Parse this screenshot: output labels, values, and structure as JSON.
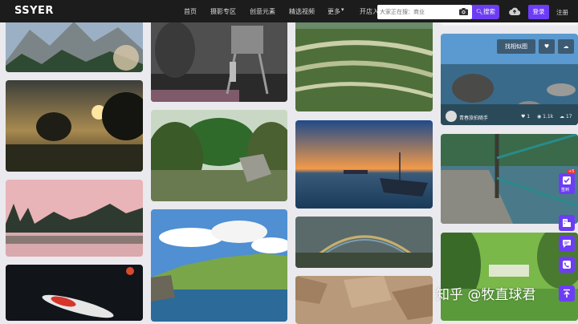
{
  "brand": {
    "logo": "SSYER"
  },
  "nav": {
    "items": [
      "首页",
      "摄影专区",
      "创意元素",
      "精选视频",
      "更多",
      "开店入驻"
    ]
  },
  "search": {
    "placeholder": "大家正在搜：商业",
    "button": "搜索"
  },
  "auth": {
    "login": "登录",
    "register": "注册"
  },
  "image_tools": {
    "find_similar": "找相似图"
  },
  "card_meta": {
    "author": "青春旅拍随手",
    "likes": "1",
    "views": "1.1k",
    "downloads": "17"
  },
  "sidebar": {
    "badge": "+5",
    "signin_label": "签到"
  },
  "watermark": "知乎 @牧直球君",
  "colors": {
    "accent": "#6d3df5",
    "nav_bg": "#1c1c1c",
    "page_bg": "#e9e9ee"
  }
}
